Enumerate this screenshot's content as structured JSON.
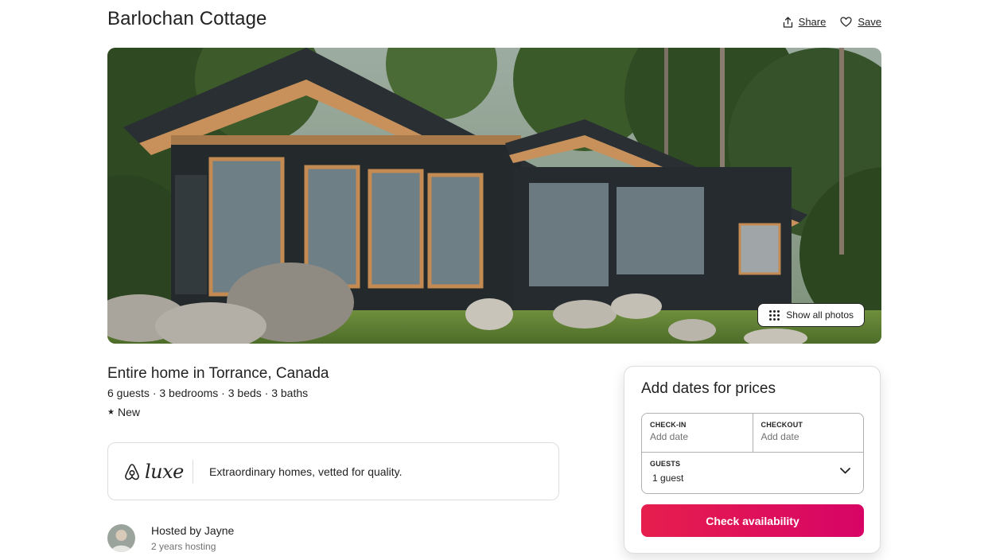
{
  "listing": {
    "title": "Barlochan Cottage",
    "heading": "Entire home in Torrance, Canada",
    "details": "6 guests · 3 bedrooms · 3 beds · 3 baths",
    "rating_star": "★",
    "rating_label": "New"
  },
  "header": {
    "share_label": "Share",
    "save_label": "Save"
  },
  "gallery": {
    "show_all_label": "Show all photos"
  },
  "luxe": {
    "brand_word": "luxe",
    "tagline": "Extraordinary homes, vetted for quality."
  },
  "host": {
    "name": "Hosted by Jayne",
    "tenure": "2 years hosting"
  },
  "booking": {
    "title": "Add dates for prices",
    "checkin_label": "CHECK-IN",
    "checkin_value": "Add date",
    "checkout_label": "CHECKOUT",
    "checkout_value": "Add date",
    "guests_label": "GUESTS",
    "guests_value": "1 guest",
    "cta_label": "Check availability"
  },
  "colors": {
    "brand": "#e61e4d",
    "text": "#222222",
    "muted": "#717171",
    "border": "#dddddd"
  },
  "icons": {
    "share": "share-icon",
    "save": "heart-icon",
    "grid": "grid-icon",
    "airbnb": "airbnb-logo-icon",
    "chevron": "chevron-down-icon"
  }
}
